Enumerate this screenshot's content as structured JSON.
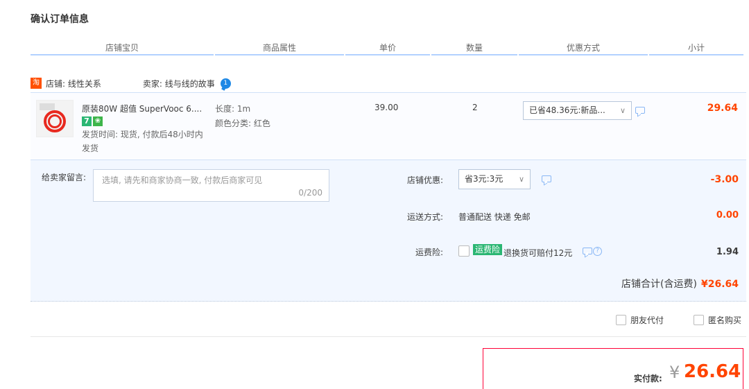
{
  "page_title": "确认订单信息",
  "columns": [
    "店铺宝贝",
    "商品属性",
    "单价",
    "数量",
    "优惠方式",
    "小计"
  ],
  "shop": {
    "badge": "淘",
    "shop_label": "店铺: 线性关系",
    "seller_label": "卖家: 线与线的故事",
    "ww_icon_text": "1"
  },
  "item": {
    "title": "原装80W 超值 SuperVooc 6....",
    "badge_7": "7",
    "ship_time": "发货时间: 现货, 付款后48小时内发货",
    "attr_length": "长度: 1m",
    "attr_color": "颜色分类: 红色",
    "unit_price": "39.00",
    "quantity": "2",
    "discount": "已省48.36元:新品...",
    "subtotal": "29.64"
  },
  "message": {
    "label": "给卖家留言:",
    "placeholder": "选填, 请先和商家协商一致, 付款后商家可见",
    "count": "0/200"
  },
  "shop_discount": {
    "label": "店铺优惠:",
    "value": "省3元:3元",
    "amount": "-3.00"
  },
  "shipping": {
    "label": "运送方式:",
    "value": "普通配送 快递 免邮",
    "amount": "0.00"
  },
  "insurance": {
    "label": "运费险:",
    "tag": "运费险",
    "text": "退换货可赔付12元",
    "amount": "1.94"
  },
  "shop_total": {
    "label": "店铺合计(含运费)",
    "amount": "¥26.64"
  },
  "options": {
    "friend_pay": "朋友代付",
    "anonymous": "匿名购买"
  },
  "payment": {
    "label": "实付款:",
    "currency": "¥",
    "amount": "26.64"
  },
  "colors": {
    "accent_orange": "#ff4400",
    "header_border": "#b2d1ff",
    "badge_green": "#2bb673"
  }
}
